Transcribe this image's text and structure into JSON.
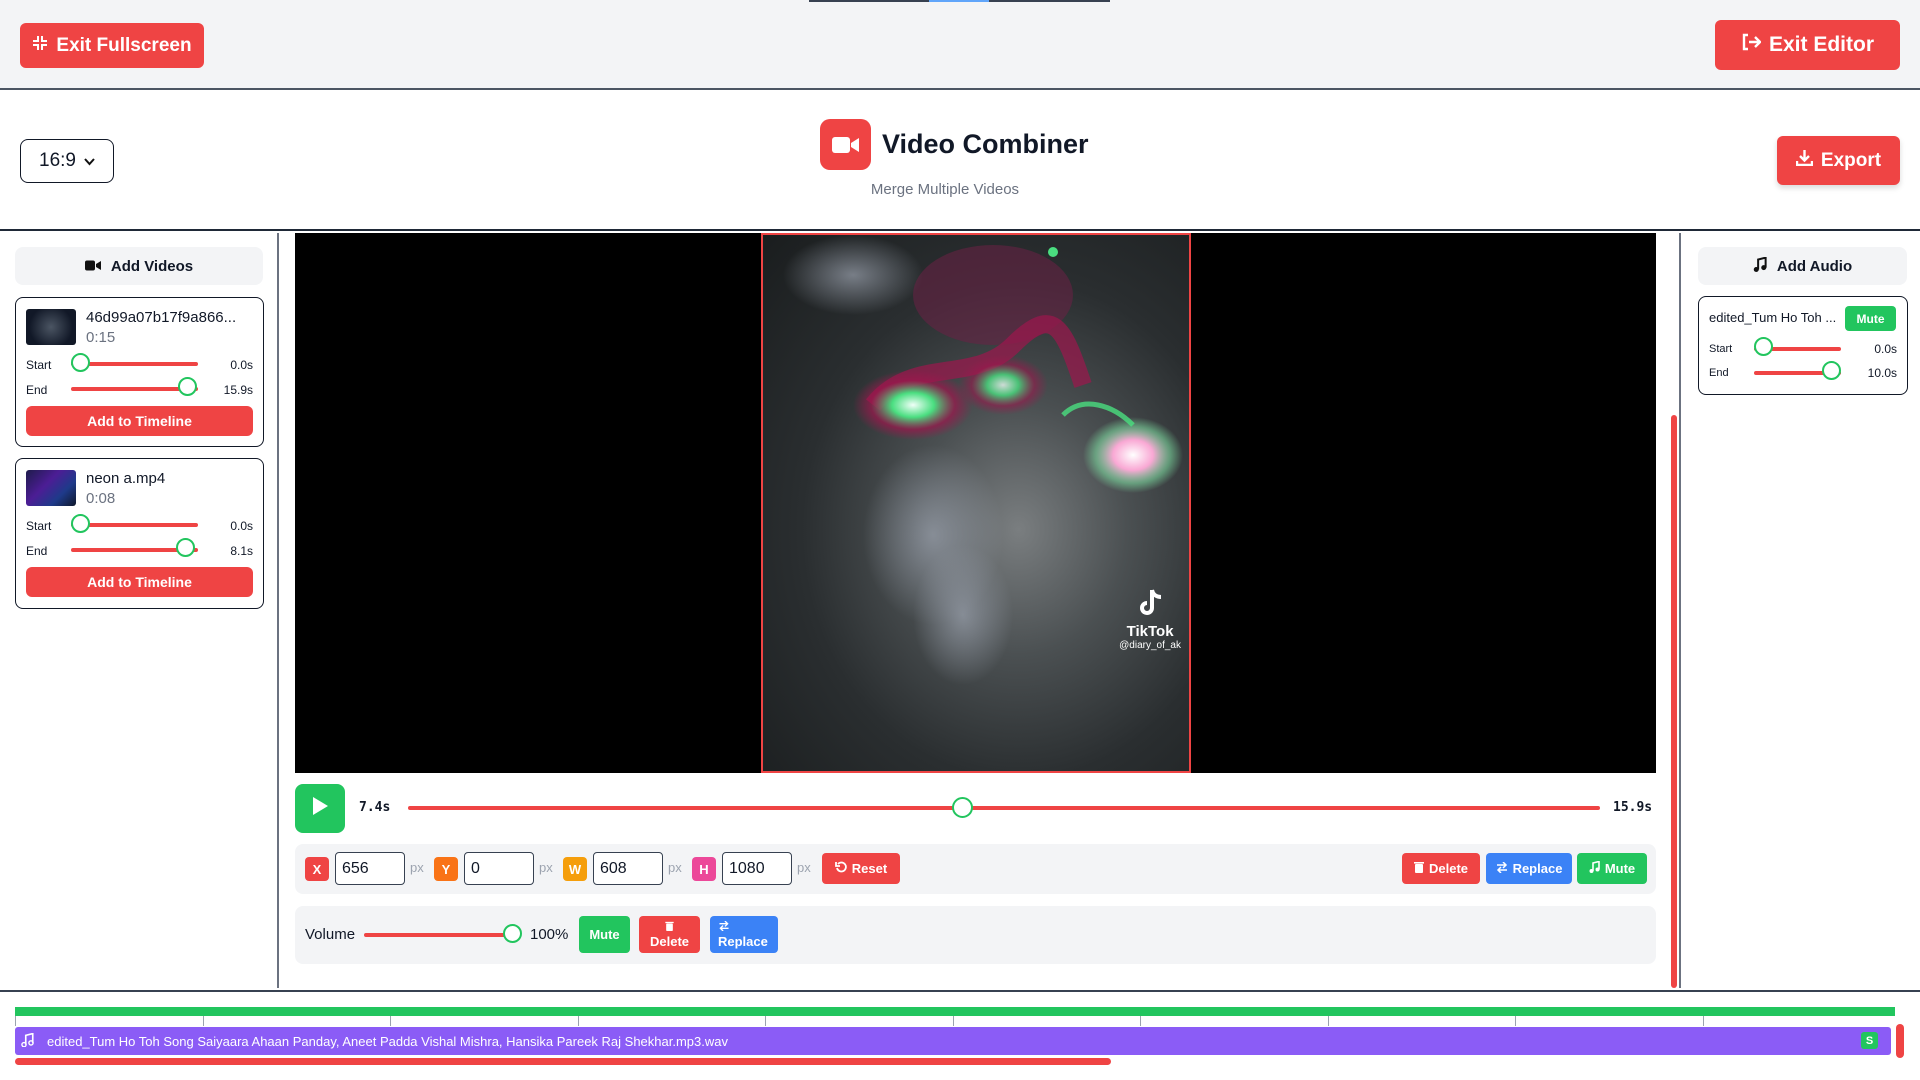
{
  "topbar": {
    "exit_fullscreen_label": "Exit Fullscreen",
    "exit_editor_label": "Exit Editor"
  },
  "header": {
    "aspect_ratio": "16:9",
    "title": "Video Combiner",
    "subtitle": "Merge Multiple Videos",
    "export_label": "Export"
  },
  "left_panel": {
    "header_label": "Add Videos",
    "clips": [
      {
        "name": "46d99a07b17f9a866...",
        "duration": "0:15",
        "start_label": "Start",
        "start_value": "0.0s",
        "end_label": "End",
        "end_value": "15.9s",
        "add_label": "Add to Timeline"
      },
      {
        "name": "neon a.mp4",
        "duration": "0:08",
        "start_label": "Start",
        "start_value": "0.0s",
        "end_label": "End",
        "end_value": "8.1s",
        "add_label": "Add to Timeline"
      }
    ]
  },
  "preview": {
    "watermark_name": "TikTok",
    "watermark_handle": "@diary_of_ak",
    "current_time": "7.4s",
    "total_time": "15.9s",
    "seek_fraction": 0.465
  },
  "transform": {
    "x_tag": "X",
    "x_value": "656",
    "y_tag": "Y",
    "y_value": "0",
    "w_tag": "W",
    "w_value": "608",
    "h_tag": "H",
    "h_value": "1080",
    "unit": "px",
    "reset_label": "Reset",
    "delete_label": "Delete",
    "replace_label": "Replace",
    "mute_label": "Mute"
  },
  "volume": {
    "label": "Volume",
    "value": "100%",
    "mute_label": "Mute",
    "delete_label": "Delete",
    "replace_label": "Replace"
  },
  "right_panel": {
    "header_label": "Add Audio",
    "audio": {
      "name": "edited_Tum Ho Toh ...",
      "mute_label": "Mute",
      "start_label": "Start",
      "start_value": "0.0s",
      "end_label": "End",
      "end_value": "10.0s"
    }
  },
  "timeline": {
    "audio_track_label": "edited_Tum Ho Toh Song Saiyaara Ahaan Panday, Aneet Padda Vishal Mishra, Hansika Pareek Raj Shekhar.mp3.wav",
    "audio_badge": "S"
  },
  "colors": {
    "accent_red": "#ef4444",
    "accent_green": "#22c55e",
    "accent_blue": "#3b82f6",
    "audio_purple": "#8b5cf6"
  }
}
